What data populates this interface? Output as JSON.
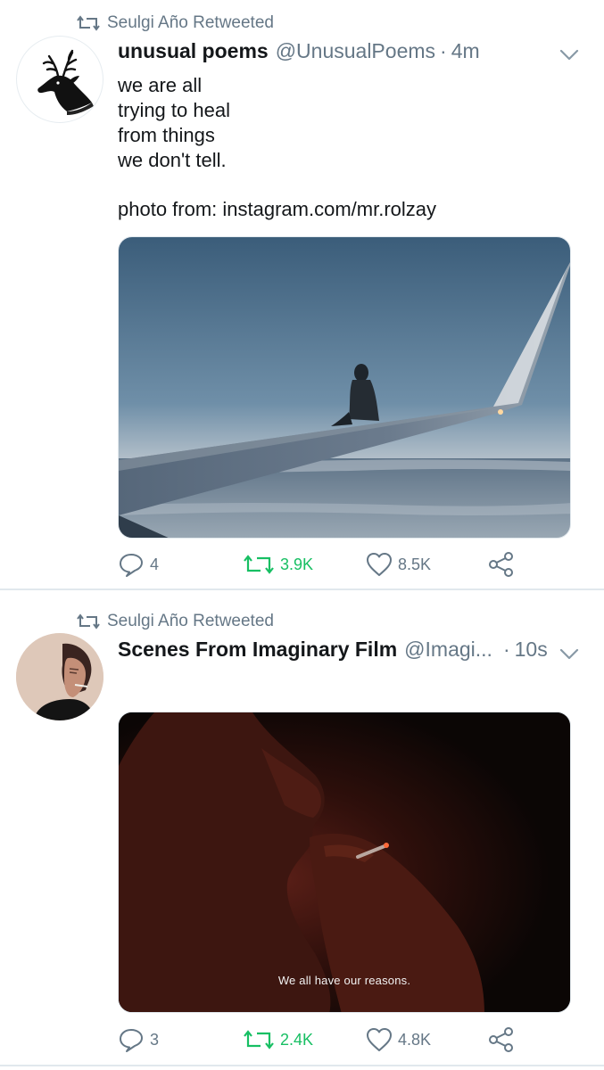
{
  "tweets": [
    {
      "retweeted_by": "Seulgi Año Retweeted",
      "name": "unusual poems",
      "handle": "@UnusualPoems",
      "separator": "·",
      "time": "4m",
      "text_lines": [
        "we are all",
        "trying to heal",
        "from things",
        "we don't tell.",
        "",
        "photo from: instagram.com/mr.rolzay"
      ],
      "avatar_icon": "deer-head-icon",
      "media_description_icon": "airplane-wing-photo",
      "replies": "4",
      "retweets": "3.9K",
      "likes": "8.5K"
    },
    {
      "retweeted_by": "Seulgi Año Retweeted",
      "name": "Scenes From Imaginary Film",
      "handle": "@Imagi...",
      "separator": "·",
      "time": "10s",
      "media_subtitle": "We all have our reasons.",
      "replies": "3",
      "retweets": "2.4K",
      "likes": "4.8K"
    }
  ],
  "colors": {
    "retweet_green": "#17bf63",
    "meta_gray": "#657786",
    "divider": "#e1e8ed"
  }
}
